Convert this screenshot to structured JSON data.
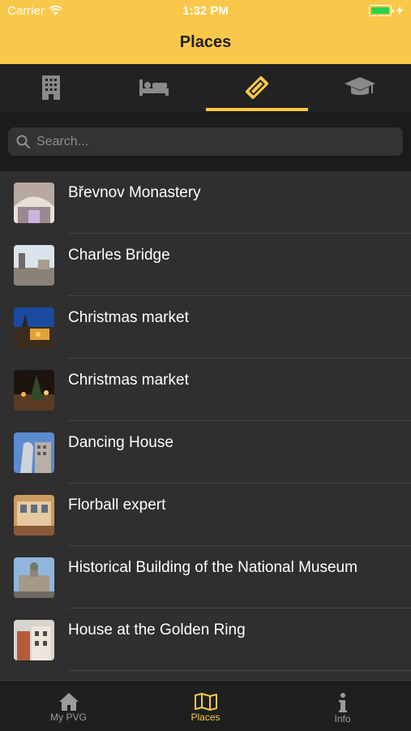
{
  "status_bar": {
    "carrier": "Carrier",
    "time": "1:32 PM"
  },
  "header": {
    "title": "Places"
  },
  "category_tabs": [
    {
      "icon": "building-icon"
    },
    {
      "icon": "bed-icon"
    },
    {
      "icon": "ticket-icon",
      "active": true
    },
    {
      "icon": "graduation-cap-icon"
    }
  ],
  "search": {
    "placeholder": "Search..."
  },
  "places": [
    {
      "name": "Břevnov Monastery"
    },
    {
      "name": "Charles Bridge"
    },
    {
      "name": "Christmas market"
    },
    {
      "name": "Christmas market"
    },
    {
      "name": "Dancing House"
    },
    {
      "name": "Florball expert"
    },
    {
      "name": "Historical Building of the National Museum"
    },
    {
      "name": "House at the Golden Ring"
    }
  ],
  "tabbar": [
    {
      "label": "My PVG",
      "icon": "home-icon"
    },
    {
      "label": "Places",
      "icon": "map-icon",
      "active": true
    },
    {
      "label": "Info",
      "icon": "info-icon"
    }
  ],
  "colors": {
    "accent": "#f9c84a",
    "background": "#2f2f2f",
    "tab_bg": "#222222"
  }
}
